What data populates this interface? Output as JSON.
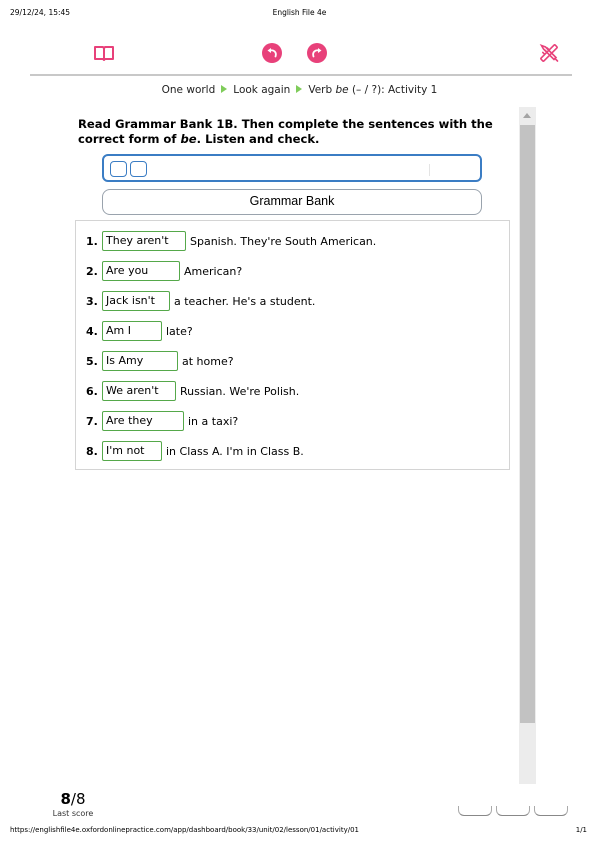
{
  "print_header": {
    "datetime": "29/12/24, 15:45",
    "title": "English File 4e"
  },
  "toolbar": {
    "icons": [
      "book-icon",
      "undo-icon",
      "redo-icon",
      "tools-icon"
    ],
    "accent_color": "#e8417a"
  },
  "breadcrumb": {
    "items": [
      "One world",
      "Look again"
    ],
    "current_prefix": "Verb ",
    "current_italic": "be",
    "current_suffix": " (– / ?): Activity 1",
    "separator_color": "#7fcc5a"
  },
  "instructions": {
    "part1": "Read Grammar Bank 1B. Then complete the sentences with the correct form of ",
    "italic": "be",
    "part2": ". Listen and check."
  },
  "audio": {
    "border_color": "#3b7dc4"
  },
  "grammar_bank_button": {
    "label": "Grammar Bank"
  },
  "questions": [
    {
      "num": "1.",
      "answer": "They aren't",
      "rest": "Spanish. They're South American."
    },
    {
      "num": "2.",
      "answer": "Are you",
      "rest": "American?"
    },
    {
      "num": "3.",
      "answer": "Jack isn't",
      "rest": "a teacher. He's a student."
    },
    {
      "num": "4.",
      "answer": "Am I",
      "rest": "late?"
    },
    {
      "num": "5.",
      "answer": "Is Amy",
      "rest": "at home?"
    },
    {
      "num": "6.",
      "answer": "We aren't",
      "rest": "Russian. We're Polish."
    },
    {
      "num": "7.",
      "answer": "Are they",
      "rest": "in a taxi?"
    },
    {
      "num": "8.",
      "answer": "I'm not",
      "rest": "in Class A. I'm in Class B."
    }
  ],
  "answer_border_color": "#55a84a",
  "score": {
    "value": "8",
    "total": "/8",
    "label": "Last score"
  },
  "footer": {
    "url": "https://englishfile4e.oxfordonlinepractice.com/app/dashboard/book/33/unit/02/lesson/01/activity/01",
    "page": "1/1"
  }
}
